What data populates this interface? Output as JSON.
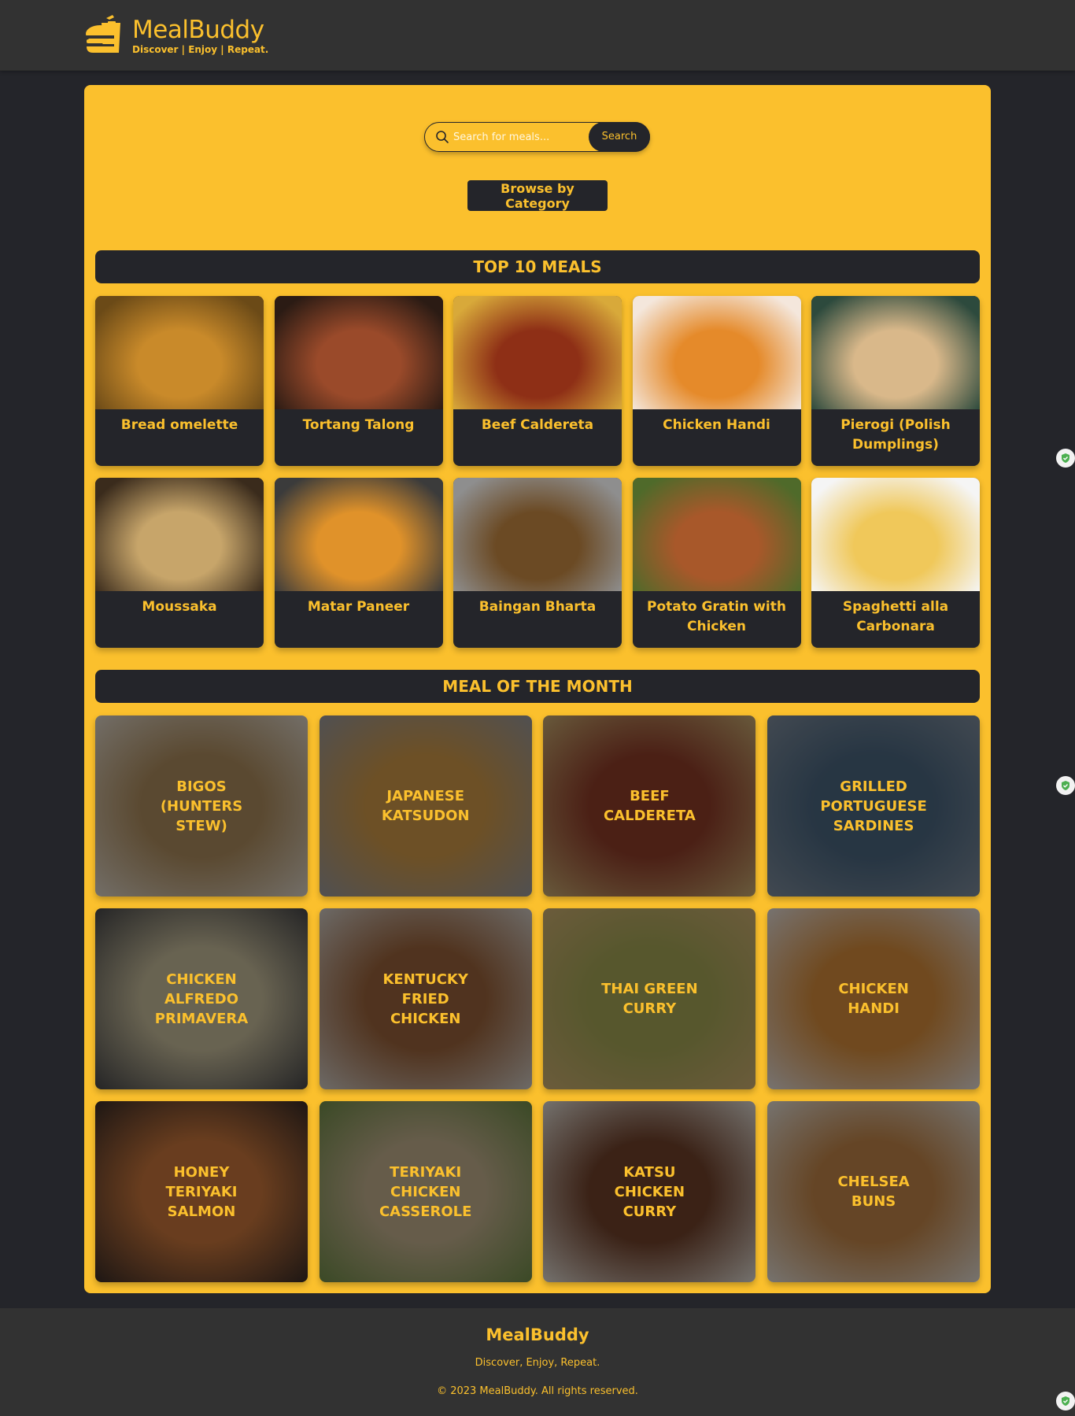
{
  "header": {
    "brand_title": "MealBuddy",
    "brand_tagline": "Discover | Enjoy | Repeat.",
    "logo_icon": "burger-bag-icon"
  },
  "search": {
    "placeholder": "Search for meals...",
    "button_label": "Search"
  },
  "browse_label": "Browse by Category",
  "top_meals": {
    "title": "TOP 10 MEALS",
    "items": [
      {
        "name": "Bread omelette",
        "palette": [
          "#c98a2a",
          "#6b4a17"
        ]
      },
      {
        "name": "Tortang Talong",
        "palette": [
          "#9a4a2a",
          "#2b1b14"
        ]
      },
      {
        "name": "Beef Caldereta",
        "palette": [
          "#8e2f16",
          "#d8a93a"
        ]
      },
      {
        "name": "Chicken Handi",
        "palette": [
          "#e58a2a",
          "#f4e7dc"
        ]
      },
      {
        "name": "Pierogi (Polish Dumplings)",
        "palette": [
          "#d9b88a",
          "#2d4a3d"
        ]
      },
      {
        "name": "Moussaka",
        "palette": [
          "#c7a56a",
          "#3a2b1c"
        ]
      },
      {
        "name": "Matar Paneer",
        "palette": [
          "#e0922a",
          "#3b3b3b"
        ]
      },
      {
        "name": "Baingan Bharta",
        "palette": [
          "#6b4a24",
          "#8e8e8e"
        ]
      },
      {
        "name": "Potato Gratin with Chicken",
        "palette": [
          "#a8582a",
          "#4f6a2a"
        ]
      },
      {
        "name": "Spaghetti alla Carbonara",
        "palette": [
          "#f0c85a",
          "#f5f5f5"
        ]
      }
    ]
  },
  "meal_of_month": {
    "title": "MEAL OF THE MONTH",
    "items": [
      {
        "name": "Bigos (Hunters Stew)",
        "palette": [
          "#b08a52",
          "#e6dccb"
        ]
      },
      {
        "name": "Japanese Katsudon",
        "palette": [
          "#d9993a",
          "#9a9a9a"
        ]
      },
      {
        "name": "Beef Caldereta",
        "palette": [
          "#8e2f16",
          "#cfae6a"
        ]
      },
      {
        "name": "Grilled Portuguese Sardines",
        "palette": [
          "#3f5f7a",
          "#7a8a9a"
        ]
      },
      {
        "name": "Chicken Alfredo Primavera",
        "palette": [
          "#cfc39a",
          "#3a3a3a"
        ]
      },
      {
        "name": "Kentucky Fried Chicken",
        "palette": [
          "#9a5a2a",
          "#d9d2c8"
        ]
      },
      {
        "name": "Thai Green Curry",
        "palette": [
          "#a8a84a",
          "#d6b36a"
        ]
      },
      {
        "name": "Chicken Handi",
        "palette": [
          "#e08a2a",
          "#efe6de"
        ]
      },
      {
        "name": "Honey Teriyaki Salmon",
        "palette": [
          "#d0702a",
          "#2a1a12"
        ]
      },
      {
        "name": "Teriyaki Chicken Casserole",
        "palette": [
          "#c9b48a",
          "#6a8a3a"
        ]
      },
      {
        "name": "Katsu Chicken Curry",
        "palette": [
          "#6a3418",
          "#e9e3d8"
        ]
      },
      {
        "name": "Chelsea Buns",
        "palette": [
          "#c8823a",
          "#ede6da"
        ]
      }
    ]
  },
  "footer": {
    "title": "MealBuddy",
    "tagline": "Discover, Enjoy, Repeat.",
    "copyright": "© 2023 MealBuddy. All rights reserved."
  },
  "colors": {
    "accent": "#fbc02d",
    "dark": "#24252a",
    "header_bg": "#323232"
  }
}
